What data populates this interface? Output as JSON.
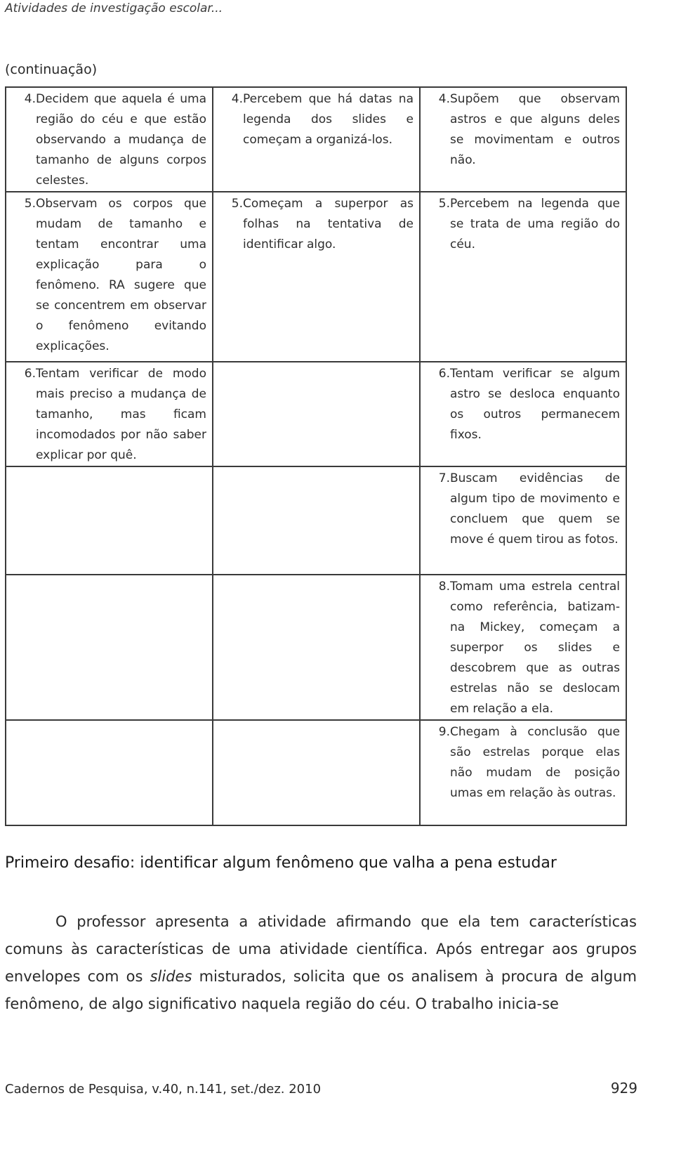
{
  "header": {
    "running_title": "Atividades de investigação escolar...",
    "continuation": "(continuação)"
  },
  "table": {
    "rows": [
      {
        "cells": [
          {
            "num": "4.",
            "text": "Decidem que aquela é uma região do céu e que estão observando a mudança de tamanho de alguns corpos celestes."
          },
          {
            "num": "4.",
            "text": "Percebem que há datas na legenda dos slides e começam a organizá-los."
          },
          {
            "num": "4.",
            "text": "Supõem que observam astros e que alguns deles se movimentam e outros não."
          }
        ]
      },
      {
        "cells": [
          {
            "num": "5.",
            "text": "Observam os corpos que mudam de tamanho e tentam encontrar uma explicação para o fenômeno. RA sugere que se concentrem em observar o fenômeno evitando explicações."
          },
          {
            "num": "5.",
            "text": "Começam a superpor as folhas na tentativa de identificar algo."
          },
          {
            "num": "5.",
            "text": "Percebem na legenda que se trata de uma região do céu."
          }
        ]
      },
      {
        "cells": [
          {
            "num": "6.",
            "text": "Tentam verificar de modo mais preciso a mudança de tamanho, mas ficam incomodados por não saber explicar por quê."
          },
          {
            "num": "",
            "text": ""
          },
          {
            "num": "6.",
            "text": "Tentam verificar se algum astro se desloca enquanto os outros permanecem fixos."
          }
        ]
      },
      {
        "cells": [
          {
            "num": "",
            "text": ""
          },
          {
            "num": "",
            "text": ""
          },
          {
            "num": "7.",
            "text": "Buscam evidências de algum tipo de movimento e concluem que quem se move é quem tirou as fotos."
          }
        ]
      },
      {
        "cells": [
          {
            "num": "",
            "text": ""
          },
          {
            "num": "",
            "text": ""
          },
          {
            "num": "8.",
            "text": "Tomam uma estrela central como referência, batizam-na Mickey, começam a superpor os slides e descobrem que as outras estrelas não se deslocam em relação a ela."
          }
        ]
      },
      {
        "cells": [
          {
            "num": "",
            "text": ""
          },
          {
            "num": "",
            "text": ""
          },
          {
            "num": "9.",
            "text": "Chegam à conclusão que são estrelas porque elas não mudam de posição umas em relação às outras."
          }
        ]
      }
    ]
  },
  "section": {
    "heading": "Primeiro desafio: identificar algum fenômeno que valha a pena estudar",
    "paragraph_part1": "O professor apresenta a atividade afirmando que ela tem características comuns às características de uma atividade científica. Após entregar aos grupos envelopes com os ",
    "paragraph_italic": "slides",
    "paragraph_part2": " misturados, solicita que os analisem à procura de algum fenômeno, de algo significativo naquela região do céu. O trabalho inicia-se"
  },
  "footer": {
    "journal": "Cadernos de Pesquisa, v.40, n.141, set./dez. 2010",
    "page_number": "929"
  }
}
